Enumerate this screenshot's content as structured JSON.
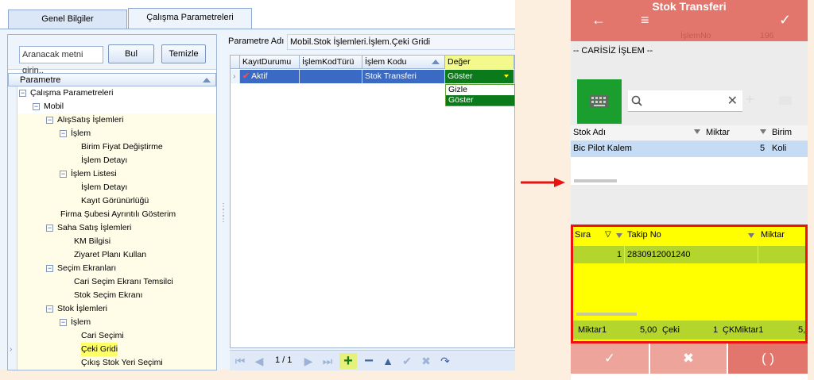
{
  "desktop": {
    "tabs": [
      "Genel Bilgiler",
      "Çalışma Parametreleri"
    ],
    "search_placeholder": "Aranacak metni girin..",
    "find_button": "Bul",
    "clear_button": "Temizle",
    "tree_header": "Parametre",
    "tree": [
      {
        "label": "Çalışma Parametreleri",
        "level": 0,
        "toggle": "−"
      },
      {
        "label": "Mobil",
        "level": 1,
        "toggle": "−"
      },
      {
        "label": "AlışSatış İşlemleri",
        "level": 2,
        "toggle": "−"
      },
      {
        "label": "İşlem",
        "level": 3,
        "toggle": "−"
      },
      {
        "label": "Birim Fiyat Değiştirme",
        "level": 4,
        "toggle": ""
      },
      {
        "label": "İşlem Detayı",
        "level": 4,
        "toggle": ""
      },
      {
        "label": "İşlem Listesi",
        "level": 3,
        "toggle": "−"
      },
      {
        "label": "İşlem Detayı",
        "level": 4,
        "toggle": ""
      },
      {
        "label": "Kayıt Görünürlüğü",
        "level": 4,
        "toggle": ""
      },
      {
        "label": "Firma Şubesi Ayrıntılı Gösterim",
        "level": 2.5,
        "toggle": ""
      },
      {
        "label": "Saha Satış İşlemleri",
        "level": 2,
        "toggle": "−"
      },
      {
        "label": "KM Bilgisi",
        "level": 3.5,
        "toggle": ""
      },
      {
        "label": "Ziyaret Planı Kullan",
        "level": 3.5,
        "toggle": ""
      },
      {
        "label": "Seçim Ekranları",
        "level": 2,
        "toggle": "−"
      },
      {
        "label": "Cari Seçim Ekranı Temsilci",
        "level": 3.5,
        "toggle": ""
      },
      {
        "label": "Stok Seçim Ekranı",
        "level": 3.5,
        "toggle": ""
      },
      {
        "label": "Stok İşlemleri",
        "level": 2,
        "toggle": "−"
      },
      {
        "label": "İşlem",
        "level": 3,
        "toggle": "−"
      },
      {
        "label": "Cari Seçimi",
        "level": 4,
        "toggle": ""
      },
      {
        "label": "Çeki Gridi",
        "level": 4,
        "toggle": "",
        "highlight": true
      },
      {
        "label": "Çıkış Stok Yeri Seçimi",
        "level": 4,
        "toggle": ""
      }
    ],
    "param_label": "Parametre Adı",
    "param_value": "Mobil.Stok İşlemleri.İşlem.Çeki Gridi",
    "grid_headers": [
      "KayıtDurumu",
      "İşlemKodTürü",
      "İşlem Kodu",
      "Değer"
    ],
    "grid_row": {
      "status": "Aktif",
      "type": "",
      "code": "Stok Transferi",
      "value": "Göster"
    },
    "dropdown_options": [
      "Gizle",
      "Göster"
    ],
    "page_info": "1 / 1"
  },
  "mobile": {
    "title": "Stok Transferi",
    "sub_label": "İşlemNo",
    "sub_value": "196",
    "mode_label": "-- CARİSİZ İŞLEM --",
    "stock_headers": [
      "Stok Adı",
      "Miktar",
      "Birim"
    ],
    "stock_row": {
      "name": "Bic Pilot Kalem",
      "qty": "5",
      "unit": "Koli"
    },
    "tracking_headers": [
      "Sıra",
      "Takip No",
      "Miktar"
    ],
    "tracking_row": {
      "seq": "1",
      "tracking_no": "2830912001240",
      "qty": ""
    },
    "totals": {
      "miktar1_label": "Miktar1",
      "miktar1_value": "5,00",
      "ceki_label": "Çeki",
      "ceki_value": "1",
      "ck_label": "ÇKMiktar1",
      "ck_value": "5,"
    }
  },
  "colors": {
    "appbar": "#e3766c",
    "highlight_box": "#ff0000",
    "yellow": "#ffff00",
    "green_row": "#b4d62c",
    "keyboard": "#1a9e2d"
  }
}
